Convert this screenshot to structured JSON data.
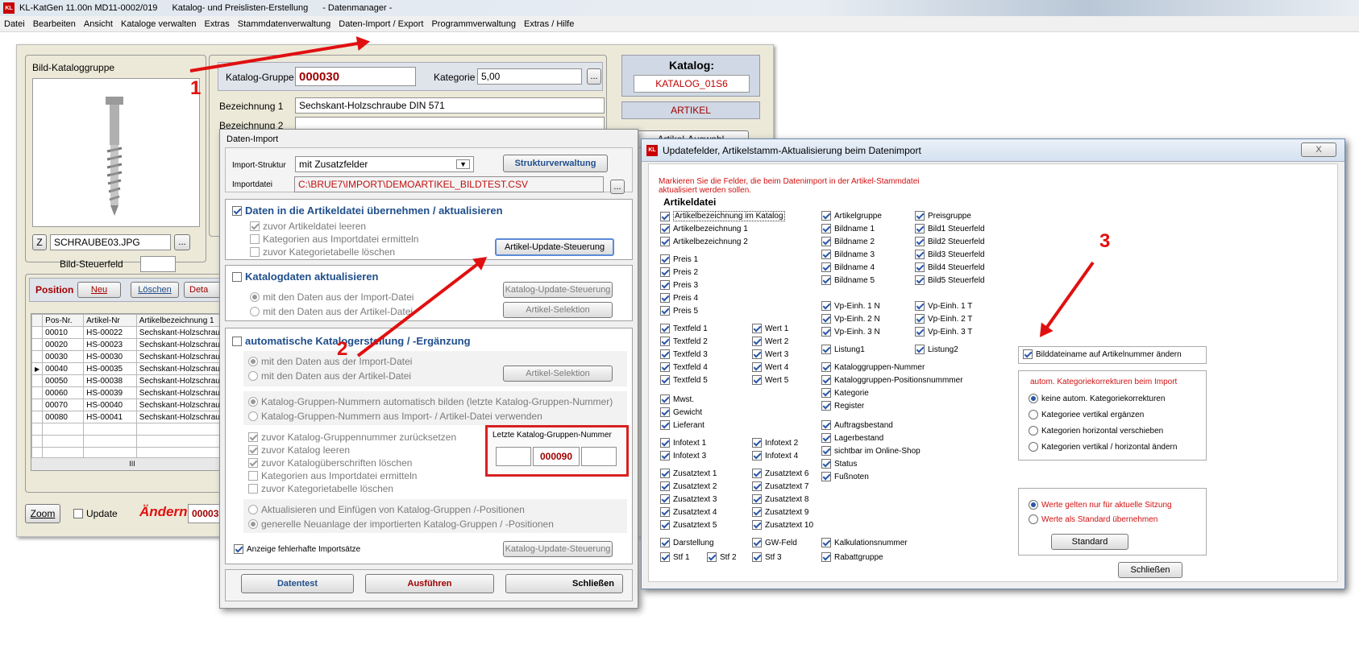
{
  "titlebar": {
    "app": "KL-KatGen 11.00n MD11-0002/019",
    "subtitle": "Katalog- und Preislisten-Erstellung",
    "module": "- Datenmanager -"
  },
  "menu": [
    "Datei",
    "Bearbeiten",
    "Ansicht",
    "Kataloge verwalten",
    "Extras",
    "Stammdatenverwaltung",
    "Daten-Import / Export",
    "Programmverwaltung",
    "Extras / Hilfe"
  ],
  "bild": {
    "title": "Bild-Kataloggruppe",
    "z": "Z",
    "filename": "SCHRAUBE03.JPG",
    "steuerfeld_label": "Bild-Steuerfeld",
    "browse": "..."
  },
  "katalog_gruppe": {
    "label": "Katalog-Gruppe",
    "value": "000030",
    "kategorie_label": "Kategorie",
    "kategorie_value": "5,00",
    "bez1_label": "Bezeichnung 1",
    "bez1_value": "Sechskant-Holzschraube DIN 571",
    "bez2_label": "Bezeichnung 2"
  },
  "katalog": {
    "title": "Katalog:",
    "name": "KATALOG_01S6",
    "artikel": "ARTIKEL",
    "auswahl": "Artikel-Auswahl"
  },
  "position": {
    "title": "Position",
    "neu": "Neu",
    "loeschen": "Löschen",
    "details": "Deta",
    "headers": [
      "Pos-Nr.",
      "Artikel-Nr",
      "Artikelbezeichnung 1"
    ],
    "rows": [
      [
        "00010",
        "HS-00022",
        "Sechskant-Holzschraube"
      ],
      [
        "00020",
        "HS-00023",
        "Sechskant-Holzschraube"
      ],
      [
        "00030",
        "HS-00030",
        "Sechskant-Holzschraube"
      ],
      [
        "00040",
        "HS-00035",
        "Sechskant-Holzschraube"
      ],
      [
        "00050",
        "HS-00038",
        "Sechskant-Holzschraube"
      ],
      [
        "00060",
        "HS-00039",
        "Sechskant-Holzschraube"
      ],
      [
        "00070",
        "HS-00040",
        "Sechskant-Holzschraube"
      ],
      [
        "00080",
        "HS-00041",
        "Sechskant-Holzschraube"
      ]
    ],
    "scroll_mark": "III"
  },
  "bottom": {
    "zoom": "Zoom",
    "update": "Update",
    "aendern": "Ändern",
    "value": "00003"
  },
  "import": {
    "title": "Daten-Import",
    "struktur_label": "Import-Struktur",
    "struktur_value": "mit Zusatzfelder",
    "strukturverwaltung": "Strukturverwaltung",
    "datei_label": "Importdatei",
    "datei_value": "C:\\BRUE7\\IMPORT\\DEMOARTIKEL_BILDTEST.CSV",
    "s1_title": "Daten in die Artikeldatei übernehmen / aktualisieren",
    "s1_a": "zuvor Artikeldatei leeren",
    "s1_b": "Kategorien aus Importdatei ermitteln",
    "s1_c": "zuvor Kategorietabelle löschen",
    "s1_btn": "Artikel-Update-Steuerung",
    "s2_title": "Katalogdaten aktualisieren",
    "s2_a": "mit den Daten aus der Import-Datei",
    "s2_b": "mit den Daten aus der Artikel-Datei",
    "s2_btn1": "Katalog-Update-Steuerung",
    "s2_btn2": "Artikel-Selektion",
    "s3_title": "automatische Katalogerstellung / -Ergänzung",
    "s3_a": "mit den Daten aus der Import-Datei",
    "s3_b": "mit den Daten aus der Artikel-Datei",
    "s3_btn": "Artikel-Selektion",
    "s3_c": "Katalog-Gruppen-Nummern automatisch bilden  (letzte Katalog-Gruppen-Nummer)",
    "s3_d": "Katalog-Gruppen-Nummern aus Import- / Artikel-Datei verwenden",
    "s3_e": "zuvor Katalog-Gruppennummer zurücksetzen",
    "s3_f": "zuvor Katalog leeren",
    "s3_g": "zuvor Katalogüberschriften löschen",
    "s3_h": "Kategorien aus Importdatei ermitteln",
    "s3_i": "zuvor Kategorietabelle löschen",
    "letzte_label": "Letzte Katalog-Gruppen-Nummer",
    "letzte_value": "000090",
    "s3_j": "Aktualisieren und  Einfügen von Katalog-Gruppen /-Positionen",
    "s3_k": "generelle Neuanlage der importierten Katalog-Gruppen / -Positionen",
    "fehler": "Anzeige fehlerhafte Importsätze",
    "fehler_btn": "Katalog-Update-Steuerung",
    "datentest": "Datentest",
    "ausfuehren": "Ausführen",
    "schliessen": "Schließen"
  },
  "update": {
    "title": "Updatefelder,  Artikelstamm-Aktualisierung beim Datenimport",
    "close": "X",
    "hint1": "Markieren Sie die Felder, die beim Datenimport in der Artikel-Stammdatei",
    "hint2": "aktualisiert werden sollen.",
    "section": "Artikeldatei",
    "col1": [
      "Artikelbezeichnung im Katalog",
      "Artikelbezeichnung 1",
      "Artikelbezeichnung 2",
      "Preis 1",
      "Preis 2",
      "Preis 3",
      "Preis 4",
      "Preis 5",
      "Textfeld 1",
      "Textfeld 2",
      "Textfeld 3",
      "Textfeld 4",
      "Textfeld 5",
      "Mwst.",
      "Gewicht",
      "Lieferant",
      "Infotext 1",
      "Infotext 3",
      "Zusatztext 1",
      "Zusatztext 2",
      "Zusatztext 3",
      "Zusatztext 4",
      "Zusatztext 5",
      "Darstellung",
      "Stf 1"
    ],
    "col2": [
      "Wert 1",
      "Wert 2",
      "Wert 3",
      "Wert 4",
      "Wert 5",
      "Infotext 2",
      "Infotext 4",
      "Zusatztext 6",
      "Zusatztext 7",
      "Zusatztext 8",
      "Zusatztext 9",
      "Zusatztext 10",
      "GW-Feld",
      "Stf 3",
      "Stf 2"
    ],
    "col3": [
      "Artikelgruppe",
      "Bildname 1",
      "Bildname 2",
      "Bildname 3",
      "Bildname 4",
      "Bildname 5",
      "Vp-Einh. 1 N",
      "Vp-Einh. 2 N",
      "Vp-Einh. 3 N",
      "Listung1",
      "Kataloggruppen-Nummer",
      "Kataloggruppen-Positionsnummmer",
      "Kategorie",
      "Register",
      "Auftragsbestand",
      "Lagerbestand",
      "sichtbar im Online-Shop",
      "Status",
      "Fußnoten",
      "Kalkulationsnummer",
      "Rabattgruppe"
    ],
    "col4": [
      "Preisgruppe",
      "Bild1 Steuerfeld",
      "Bild2 Steuerfeld",
      "Bild3 Steuerfeld",
      "Bild4 Steuerfeld",
      "Bild5  Steuerfeld",
      "Vp-Einh. 1 T",
      "Vp-Einh. 2 T",
      "Vp-Einh. 3 T",
      "Listung2"
    ],
    "bilddatei": "Bilddateiname auf Artikelnummer ändern",
    "korr_title": "autom. Kategoriekorrekturen beim Import",
    "korr": [
      "keine autom. Kategoriekorrekturen",
      "Kategoriee vertikal ergänzen",
      "Kategorien horizontal verschieben",
      "Kategorien vertikal / horizontal ändern"
    ],
    "werte1": "Werte gelten nur für aktuelle Sitzung",
    "werte2": "Werte als Standard übernehmen",
    "standard": "Standard",
    "schliessen": "Schließen"
  },
  "annotations": [
    "1",
    "2",
    "3"
  ],
  "colors": {
    "accent_red": "#e01010",
    "dark_red": "#a00000",
    "heading_blue": "#1f4e8c"
  }
}
